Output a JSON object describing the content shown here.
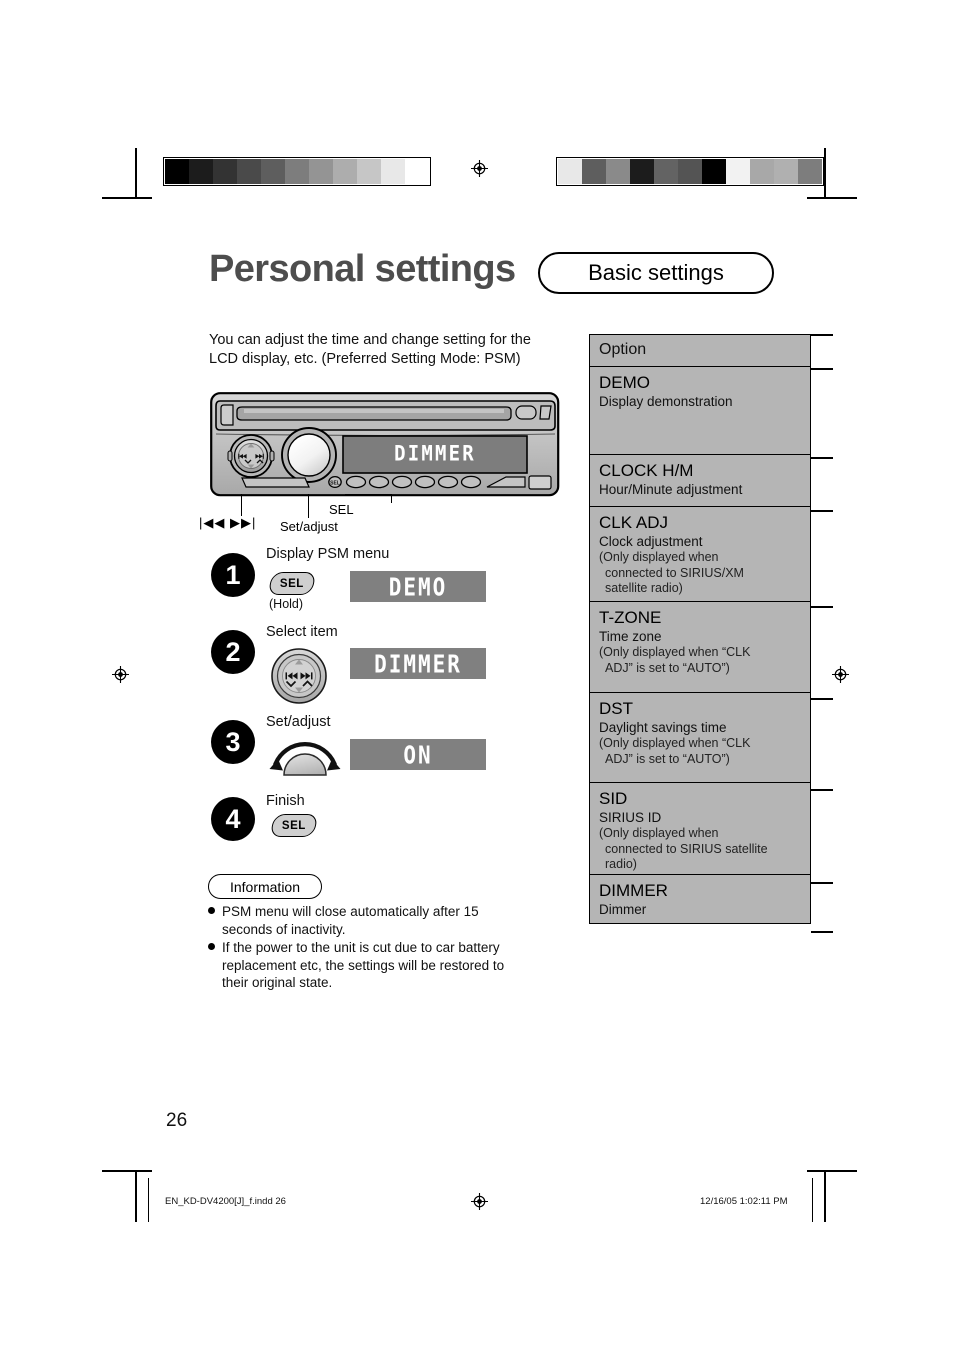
{
  "header": {
    "title": "Personal settings",
    "badge": "Basic settings"
  },
  "intro": "You can adjust the time and change setting for the LCD display, etc. (Preferred Setting Mode: PSM)",
  "device": {
    "display_text": "DIMMER",
    "callouts": {
      "skip": "|◀◀  ▶▶|",
      "set_adjust": "Set/adjust",
      "sel": "SEL"
    }
  },
  "steps": [
    {
      "number": "1",
      "label": "Display PSM menu",
      "control": "SEL",
      "sub": "(Hold)",
      "lcd": "DEMO"
    },
    {
      "number": "2",
      "label": "Select item",
      "control": "joystick",
      "sub": "",
      "lcd": "DIMMER"
    },
    {
      "number": "3",
      "label": "Set/adjust",
      "control": "knob",
      "sub": "",
      "lcd": "ON"
    },
    {
      "number": "4",
      "label": "Finish",
      "control": "SEL",
      "sub": "",
      "lcd": ""
    }
  ],
  "information": {
    "heading": "Information",
    "items": [
      "PSM menu will close automatically after 15 seconds of inactivity.",
      "If the power to the unit is cut due to car battery replacement etc, the settings will be restored to their original state."
    ]
  },
  "options_table": {
    "header": "Option",
    "rows": [
      {
        "name": "DEMO",
        "desc": "Display demonstration",
        "note1": "",
        "note2": "",
        "note3": ""
      },
      {
        "name": "CLOCK H/M",
        "desc": "Hour/Minute adjustment",
        "note1": "",
        "note2": "",
        "note3": ""
      },
      {
        "name": "CLK ADJ",
        "desc": "Clock adjustment",
        "note1": "(Only displayed when",
        "note2": "connected to SIRIUS/XM",
        "note3": "satellite radio)"
      },
      {
        "name": "T-ZONE",
        "desc": "Time zone",
        "note1": "(Only displayed when “CLK",
        "note2": "ADJ” is set to “AUTO”)",
        "note3": ""
      },
      {
        "name": "DST",
        "desc": "Daylight savings time",
        "note1": "(Only displayed when “CLK",
        "note2": "ADJ” is set to “AUTO”)",
        "note3": ""
      },
      {
        "name": "SID",
        "desc": "SIRIUS ID",
        "note1": "(Only displayed when",
        "note2": "connected to SIRIUS satellite",
        "note3": "radio)"
      },
      {
        "name": "DIMMER",
        "desc": "Dimmer",
        "note1": "",
        "note2": "",
        "note3": ""
      }
    ]
  },
  "footer": {
    "page_number": "26",
    "file_name": "EN_KD-DV4200[J]_f.indd   26",
    "timestamp": "12/16/05   1:02:11 PM"
  },
  "colorbars": {
    "left": [
      "#000000",
      "#1c1c1c",
      "#333333",
      "#4a4a4a",
      "#5e5e5e",
      "#7d7d7d",
      "#949494",
      "#adadad",
      "#c6c6c6",
      "#e8e8e8",
      "#ffffff"
    ],
    "right": [
      "#e8e8e8",
      "#5e5e5e",
      "#8a8a8a",
      "#1c1c1c",
      "#636363",
      "#545454",
      "#000000",
      "#f2f2f2",
      "#a8a8a8",
      "#b0b0b0",
      "#7d7d7d"
    ]
  },
  "colors": {
    "title": "#4d4d4d",
    "table_bg": "#b5b5b5",
    "lcd_bg": "#808080",
    "lcd_fg": "#ffffff"
  }
}
